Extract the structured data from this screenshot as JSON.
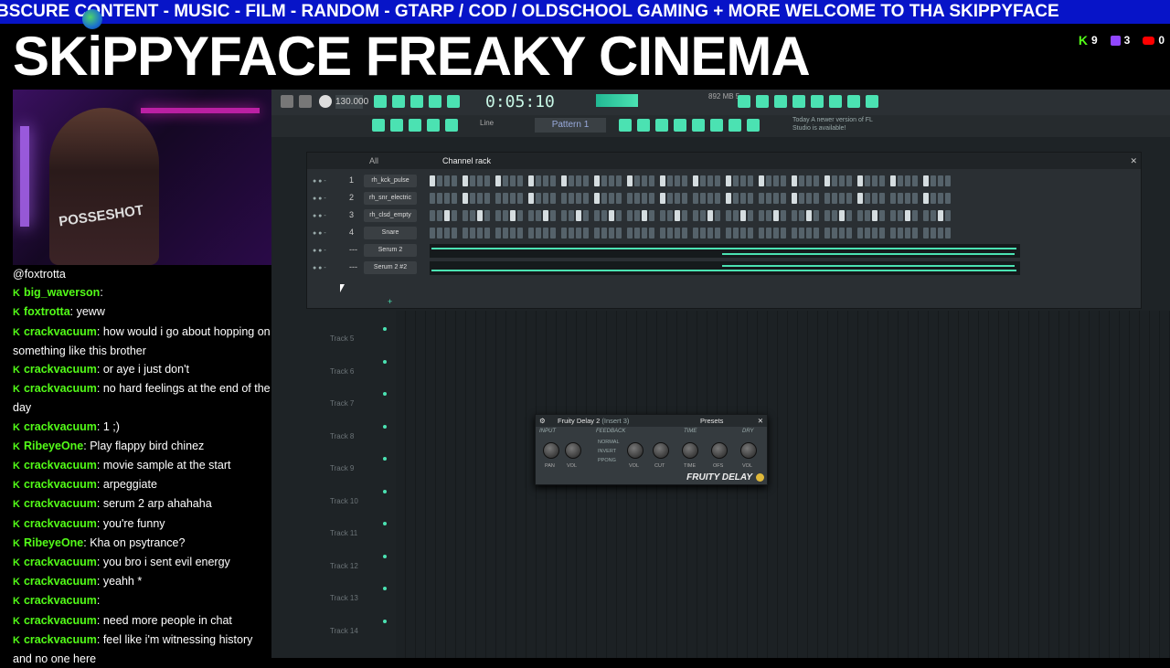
{
  "overlay": {
    "ticker_text": "BSCURE CONTENT - MUSIC - FILM - RANDOM - GTARP / COD / OLDSCHOOL GAMING + MORE  WELCOME TO THA SKIPPYFACE",
    "title": "SKiPPYFACE FREAKY CINEMA",
    "stats": [
      {
        "platform_icon": "kick-icon",
        "count": "9"
      },
      {
        "platform_icon": "twitch-icon",
        "count": "3"
      },
      {
        "platform_icon": "youtube-icon",
        "count": "0"
      }
    ],
    "webcam_shirt_text": "POSSESHOT"
  },
  "chat": {
    "messages": [
      {
        "user": "",
        "text": "@foxtrotta"
      },
      {
        "user": "big_waverson",
        "text": ""
      },
      {
        "user": "foxtrotta",
        "text": "yeww"
      },
      {
        "user": "crackvacuum",
        "text": "how would i go about hopping on something like this brother"
      },
      {
        "user": "crackvacuum",
        "text": "or aye i just don't"
      },
      {
        "user": "crackvacuum",
        "text": "no hard feelings at the end of the day"
      },
      {
        "user": "crackvacuum",
        "text": "1 ;)"
      },
      {
        "user": "RibeyeOne",
        "text": "Play flappy bird chinez"
      },
      {
        "user": "crackvacuum",
        "text": "movie sample at the start"
      },
      {
        "user": "crackvacuum",
        "text": "arpeggiate"
      },
      {
        "user": "crackvacuum",
        "text": "serum 2 arp ahahaha"
      },
      {
        "user": "crackvacuum",
        "text": "you're funny"
      },
      {
        "user": "RibeyeOne",
        "text": "Kha on psytrance?"
      },
      {
        "user": "crackvacuum",
        "text": "you bro i sent evil energy"
      },
      {
        "user": "crackvacuum",
        "text": "yeahh *"
      },
      {
        "user": "crackvacuum",
        "text": ""
      },
      {
        "user": "crackvacuum",
        "text": "need more people in chat"
      },
      {
        "user": "crackvacuum",
        "text": "feel like i'm witnessing history and no one here"
      }
    ]
  },
  "fl": {
    "tempo": "130.000",
    "time": "0:05:10",
    "mem": "892 MB\n5",
    "pattern": "Pattern 1",
    "snap": "Line",
    "news": "Today  A newer version of FL Studio is available!",
    "rack_filter": "All",
    "rack_title": "Channel rack",
    "channels": [
      {
        "num": "1",
        "name": "rh_kck_pulse",
        "type": "steps"
      },
      {
        "num": "2",
        "name": "rh_snr_electric",
        "type": "steps"
      },
      {
        "num": "3",
        "name": "rh_clsd_empty",
        "type": "steps"
      },
      {
        "num": "4",
        "name": "Snare",
        "type": "steps"
      },
      {
        "num": "---",
        "name": "Serum 2",
        "type": "piano"
      },
      {
        "num": "---",
        "name": "Serum 2 #2",
        "type": "piano"
      }
    ],
    "tracks": [
      "Track 5",
      "Track 6",
      "Track 7",
      "Track 8",
      "Track 9",
      "Track 10",
      "Track 11",
      "Track 12",
      "Track 13",
      "Track 14"
    ],
    "delay": {
      "title": "Fruity Delay 2",
      "insert": "(Insert 3)",
      "presets": "Presets",
      "sections": [
        "INPUT",
        "FEEDBACK",
        "TIME",
        "DRY"
      ],
      "modes": [
        "NORMAL",
        "INVERT",
        "PPONG"
      ],
      "knobs": [
        "PAN",
        "VOL",
        "VOL",
        "CUT",
        "TIME",
        "OFS",
        "VOL"
      ],
      "logo": "FRUITY DELAY"
    }
  }
}
